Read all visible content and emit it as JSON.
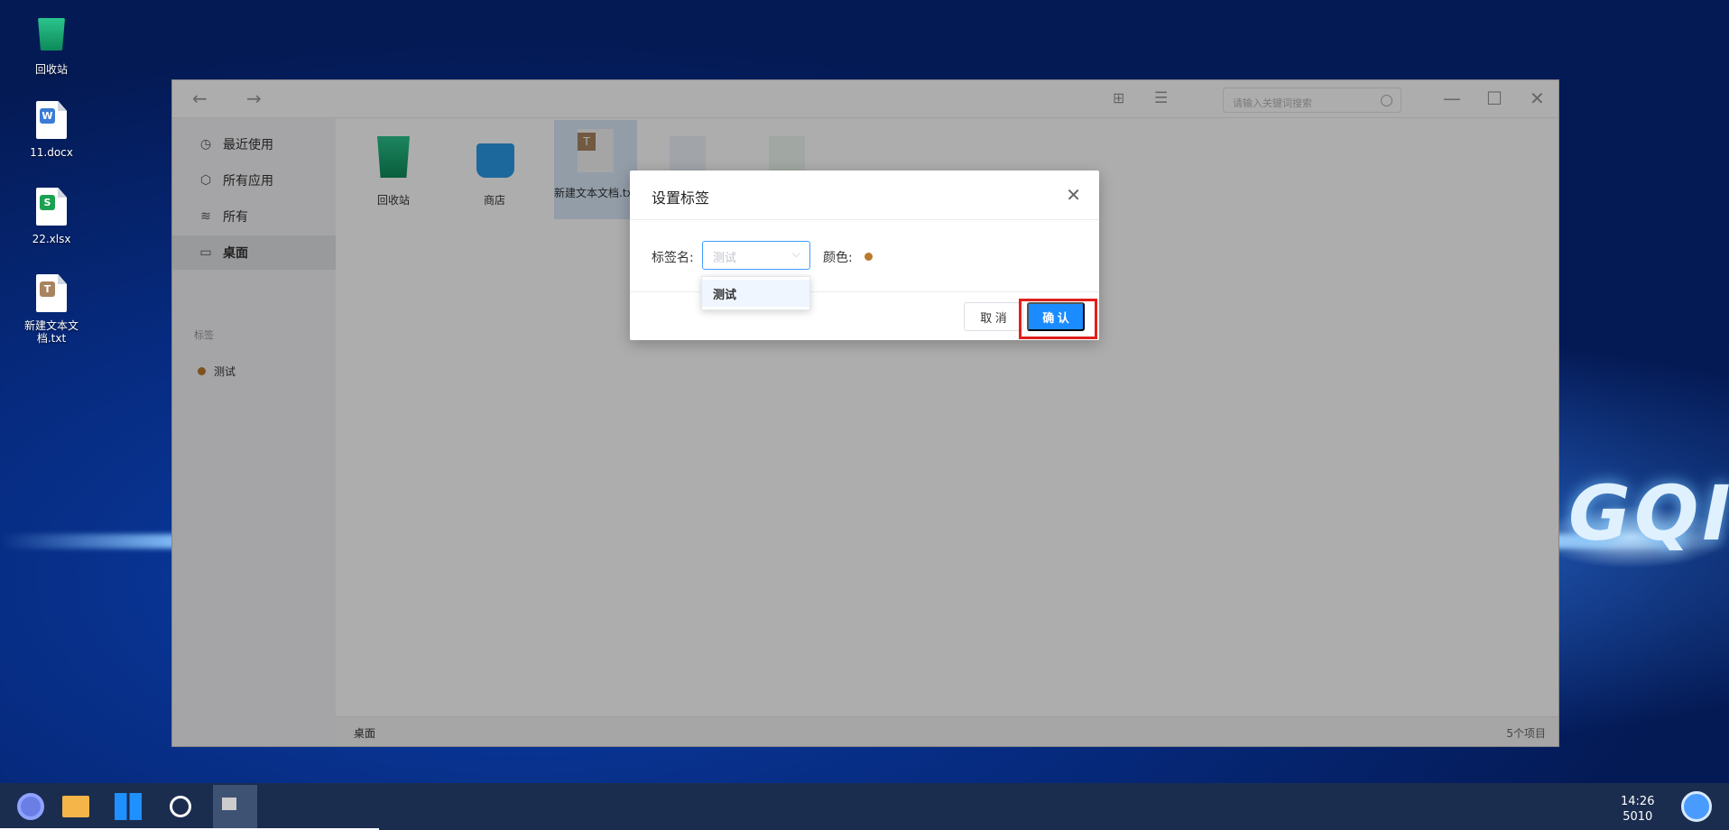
{
  "desktop": {
    "icons": [
      {
        "label": "回收站",
        "icon": "recycle-bin-icon"
      },
      {
        "label": "11.docx",
        "icon": "word-doc-icon",
        "badge": "W",
        "color": "#3a7bd5"
      },
      {
        "label": "22.xlsx",
        "icon": "excel-sheet-icon",
        "badge": "S",
        "color": "#1aa251"
      },
      {
        "label": "新建文本文档.txt",
        "icon": "text-file-icon",
        "badge": "T",
        "color": "#a88360"
      }
    ],
    "brand_text": "GQI"
  },
  "window": {
    "search_placeholder": "请输入关键词搜索",
    "sidebar": {
      "items": [
        {
          "label": "最近使用",
          "icon": "clock-icon"
        },
        {
          "label": "所有应用",
          "icon": "cube-icon"
        },
        {
          "label": "所有",
          "icon": "layers-icon"
        },
        {
          "label": "桌面",
          "icon": "monitor-icon",
          "active": true
        }
      ],
      "tags_header": "标签",
      "tags": [
        {
          "label": "测试",
          "color": "#b97a2d"
        }
      ]
    },
    "files": [
      {
        "label": "回收站"
      },
      {
        "label": "商店"
      },
      {
        "label": "新建文本文档.txt"
      }
    ],
    "status": {
      "path": "桌面",
      "count": "5个项目"
    }
  },
  "dialog": {
    "title": "设置标签",
    "name_label": "标签名:",
    "name_placeholder": "测试",
    "color_label": "颜色:",
    "color_value": "#b97a2d",
    "dropdown_options": [
      "测试"
    ],
    "cancel_label": "取 消",
    "ok_label": "确 认"
  },
  "taskbar": {
    "time": "14:26",
    "date": "5010"
  }
}
